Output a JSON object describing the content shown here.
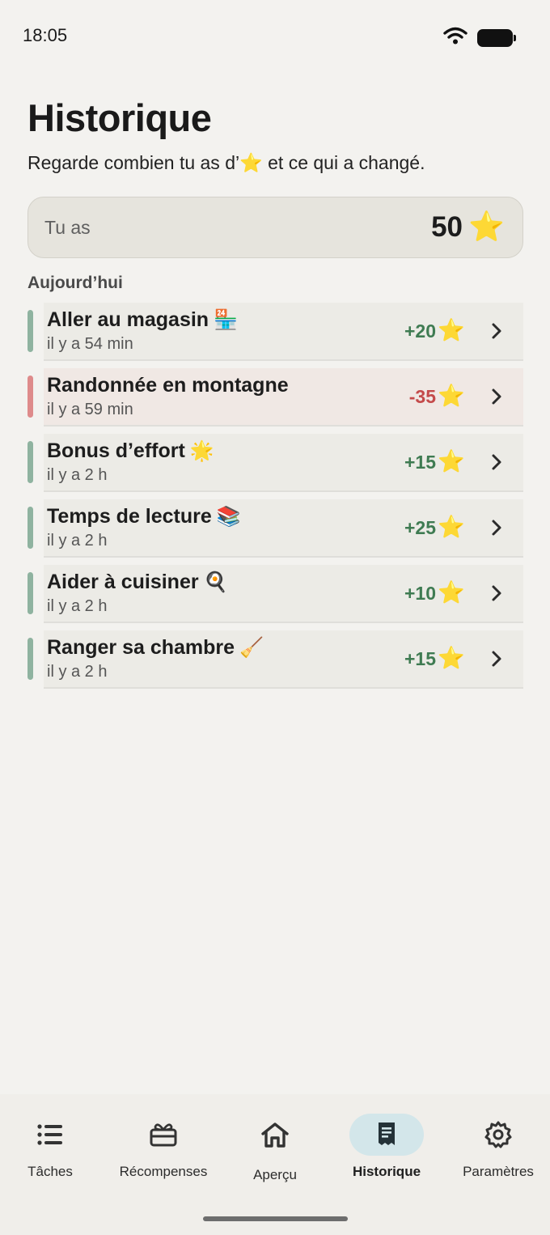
{
  "status_bar": {
    "time": "18:05"
  },
  "header": {
    "title": "Historique",
    "subtitle": "Regarde combien tu as d’⭐ et ce qui a changé."
  },
  "balance": {
    "label": "Tu as",
    "value": "50",
    "icon": "star-icon"
  },
  "section": {
    "title": "Aujourd’hui"
  },
  "history": [
    {
      "title": "Aller au magasin",
      "emoji": "🏪",
      "time": "il y a 54 min",
      "amount": "+20",
      "type": "positive"
    },
    {
      "title": "Randonnée en montagne",
      "emoji": "",
      "time": "il y a 59 min",
      "amount": "-35",
      "type": "negative"
    },
    {
      "title": "Bonus d’effort",
      "emoji": "🌟",
      "time": "il y a 2 h",
      "amount": "+15",
      "type": "positive"
    },
    {
      "title": "Temps de lecture",
      "emoji": "📚",
      "time": "il y a 2 h",
      "amount": "+25",
      "type": "positive"
    },
    {
      "title": "Aider à cuisiner",
      "emoji": "🍳",
      "time": "il y a 2 h",
      "amount": "+10",
      "type": "positive"
    },
    {
      "title": "Ranger sa chambre",
      "emoji": "🧹",
      "time": "il y a 2 h",
      "amount": "+15",
      "type": "positive"
    }
  ],
  "nav": {
    "items": [
      {
        "label": "Tâches",
        "icon": "list-icon"
      },
      {
        "label": "Récompenses",
        "icon": "gift-icon"
      },
      {
        "label": "Aperçu",
        "icon": "home-icon"
      },
      {
        "label": "Historique",
        "icon": "receipt-icon",
        "active": true
      },
      {
        "label": "Paramètres",
        "icon": "gear-icon"
      }
    ]
  },
  "colors": {
    "positive": "#3f7b52",
    "negative": "#c44a4a",
    "star": "#f4c21a",
    "active_nav_bg": "#d3e6ea"
  }
}
